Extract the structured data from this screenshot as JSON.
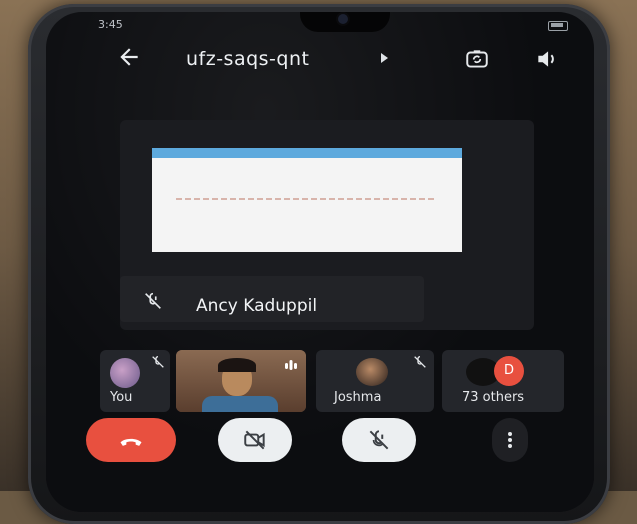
{
  "status": {
    "time": "3:45"
  },
  "meeting": {
    "code": "ufz-saqs-qnt"
  },
  "speaker": {
    "name": "Ancy Kaduppil"
  },
  "participants": [
    {
      "label": "You"
    },
    {
      "label": ""
    },
    {
      "label": "Joshma"
    },
    {
      "label": "73 others",
      "initial": "D"
    }
  ],
  "icons": {
    "back": "back-arrow-icon",
    "flip_camera": "flip-camera-icon",
    "speaker": "speaker-icon",
    "mic_off": "mic-off-icon",
    "cam_off": "camera-off-icon",
    "end_call": "end-call-icon",
    "more": "more-vertical-icon"
  },
  "colors": {
    "end_call": "#e8503f",
    "toggle_bg": "#eceff1",
    "screen_bg": "#0c0d10",
    "avatar_d": "#e8503f"
  }
}
